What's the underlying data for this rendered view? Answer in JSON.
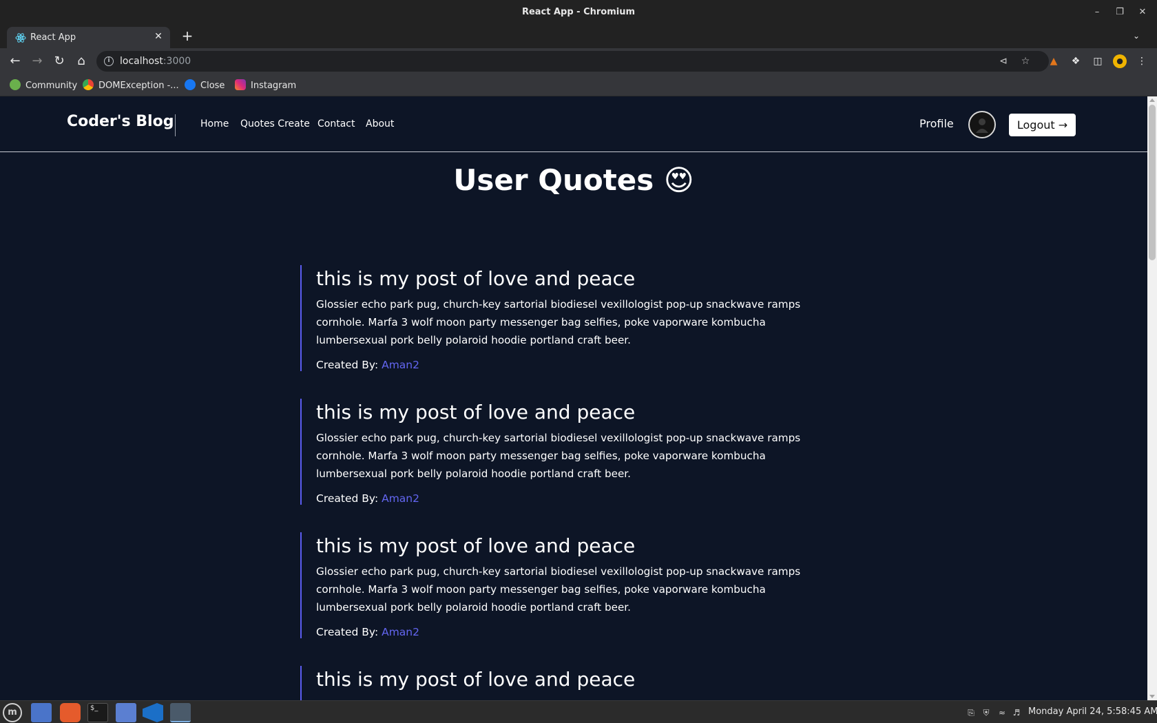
{
  "window": {
    "title": "React App - Chromium"
  },
  "tab": {
    "title": "React App"
  },
  "omnibox": {
    "host": "localhost",
    "port": ":3000"
  },
  "bookmarks": [
    {
      "label": "Community",
      "color": "#6ab04c"
    },
    {
      "label": "DOMException -...",
      "color": "#e8e8e8"
    },
    {
      "label": "Close",
      "color": "#1877f2"
    },
    {
      "label": "Instagram",
      "color": "#d6249f"
    }
  ],
  "site": {
    "brand": "Coder's Blog",
    "nav": [
      "Home",
      "Quotes Create",
      "Contact",
      "About"
    ],
    "profile": "Profile",
    "logout": "Logout →",
    "page_title": "User Quotes 😍"
  },
  "quotes": [
    {
      "title": "this is my post of love and peace",
      "body": "Glossier echo park pug, church-key sartorial biodiesel vexillologist pop-up snackwave ramps cornhole. Marfa 3 wolf moon party messenger bag selfies, poke vaporware kombucha lumbersexual pork belly polaroid hoodie portland craft beer.",
      "created_by_label": "Created By:",
      "author": "Aman2"
    },
    {
      "title": "this is my post of love and peace",
      "body": "Glossier echo park pug, church-key sartorial biodiesel vexillologist pop-up snackwave ramps cornhole. Marfa 3 wolf moon party messenger bag selfies, poke vaporware kombucha lumbersexual pork belly polaroid hoodie portland craft beer.",
      "created_by_label": "Created By:",
      "author": "Aman2"
    },
    {
      "title": "this is my post of love and peace",
      "body": "Glossier echo park pug, church-key sartorial biodiesel vexillologist pop-up snackwave ramps cornhole. Marfa 3 wolf moon party messenger bag selfies, poke vaporware kombucha lumbersexual pork belly polaroid hoodie portland craft beer.",
      "created_by_label": "Created By:",
      "author": "Aman2"
    },
    {
      "title": "this is my post of love and peace"
    }
  ],
  "taskbar": {
    "clock": "Monday April 24,  5:58:45 AM"
  },
  "colors": {
    "page_bg": "#0d1526",
    "accent": "#6366f1",
    "quote_border": "#5b5cf0"
  }
}
